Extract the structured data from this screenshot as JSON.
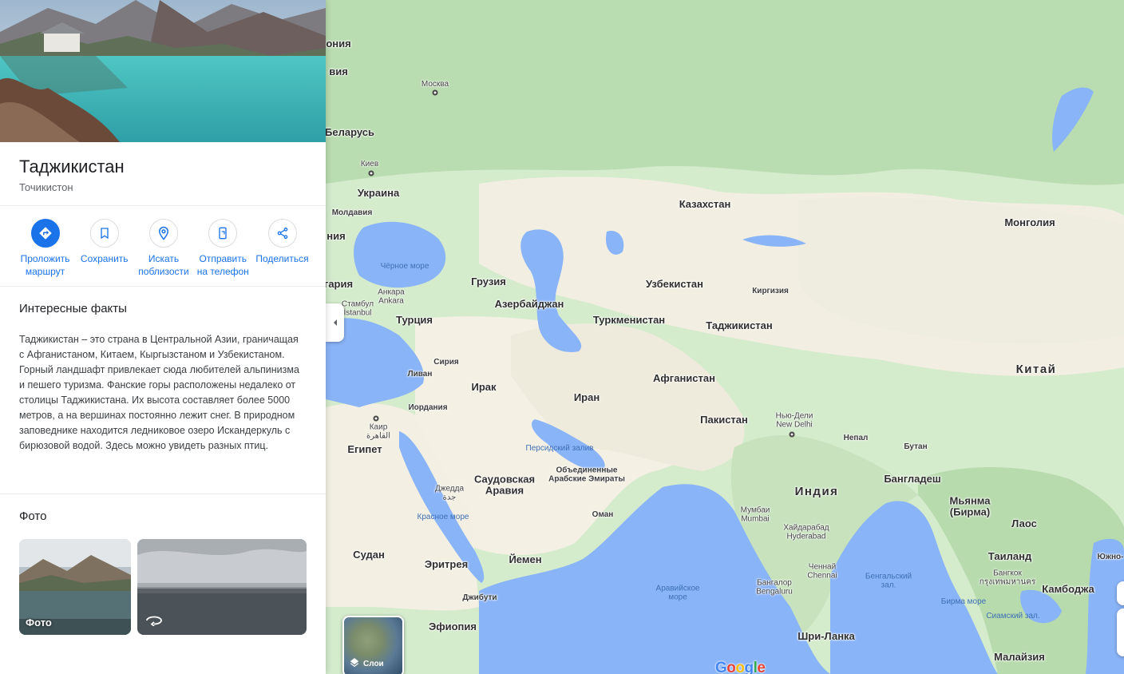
{
  "place": {
    "name": "Таджикистан",
    "local_name": "Точикистон"
  },
  "actions": [
    {
      "label": "Проложить\nмаршрут",
      "icon": "directions-icon"
    },
    {
      "label": "Сохранить",
      "icon": "bookmark-icon"
    },
    {
      "label": "Искать\nпоблизости",
      "icon": "nearby-search-icon"
    },
    {
      "label": "Отправить\nна телефон",
      "icon": "send-to-phone-icon"
    },
    {
      "label": "Поделиться",
      "icon": "share-icon"
    }
  ],
  "facts": {
    "title": "Интересные факты",
    "text": "Таджикистан – это страна в Центральной Азии, граничащая с Афганистаном, Китаем, Кыргызстаном и Узбекистаном. Горный ландшафт привлекает сюда любителей альпинизма и пешего туризма. Фанские горы расположены недалеко от столицы Таджикистана. Их высота составляет более 5000 метров, а на вершинах постоянно лежит снег. В природном заповеднике находится ледниковое озеро Искандеркуль с бирюзовой водой. Здесь можно увидеть разных птиц."
  },
  "photos": {
    "title": "Фото",
    "items": [
      {
        "label": "Фото",
        "icon": "photo-icon"
      },
      {
        "label": "",
        "icon": "360-view-icon"
      }
    ]
  },
  "map": {
    "layers_label": "Слои",
    "logo": "Google",
    "colors": {
      "water": "#8ab4f8",
      "land": "#cfe6c6",
      "desert": "#f5f1e6"
    },
    "labels": {
      "kazakhstan": "Казахстан",
      "mongolia": "Монголия",
      "uzbekistan": "Узбекистан",
      "kyrgyzstan": "Киргизия",
      "turkmenistan": "Туркменистан",
      "tajikistan": "Таджикистан",
      "china": "Китай",
      "afghanistan": "Афганистан",
      "pakistan": "Пакистан",
      "iran": "Иран",
      "iraq": "Ирак",
      "syria": "Сирия",
      "lebanon": "Ливан",
      "jordan": "Иордания",
      "turkey": "Турция",
      "georgia": "Грузия",
      "azerbaijan": "Азербайджан",
      "ukraine": "Украина",
      "moldova": "Молдавия",
      "belarus": "Беларусь",
      "egypt": "Египет",
      "sudan": "Судан",
      "eritrea": "Эритрея",
      "ethiopia": "Эфиопия",
      "djibouti": "Джибути",
      "yemen": "Йемен",
      "oman": "Оман",
      "uae": "Объединенные\nАрабские Эмираты",
      "saudi": "Саудовская\nАравия",
      "india": "Индия",
      "nepal": "Непал",
      "bhutan": "Бутан",
      "bangladesh": "Бангладеш",
      "myanmar": "Мьянма\n(Бирма)",
      "laos": "Лаос",
      "thailand": "Таиланд",
      "cambodia": "Камбоджа",
      "srilanka": "Шри-Ланка",
      "malaysia": "Малайзия",
      "moscow": "Москва",
      "kiev": "Киев",
      "ankara": "Анкара\nAnkara",
      "istanbul": "Стамбул\nİstanbul",
      "cairo": "Каир\nالقاهرة",
      "jeddah": "Джедда\nجدة",
      "newdelhi": "Нью-Дели\nNew Delhi",
      "mumbai": "Мумбаи\nMumbai",
      "hyderabad": "Хайдарабад\nHyderabad",
      "chennai": "Ченнай\nChennai",
      "bangalore": "Бангалор\nBengaluru",
      "bangkok": "Бангкок\nกรุงเทพมหานคร",
      "black_sea": "Чёрное море",
      "red_sea": "Красное море",
      "persian_gulf": "Персидский залив",
      "arabian_sea": "Аравийское\nморе",
      "bay_bengal": "Бенгальский\nзал.",
      "burma_sea": "Бирма море",
      "siam_gulf": "Сиамский зал.",
      "cut_1": "ония",
      "cut_2": "вия",
      "cut_3": "ния",
      "cut_4": "гария",
      "cut_5": "Южно-"
    }
  }
}
